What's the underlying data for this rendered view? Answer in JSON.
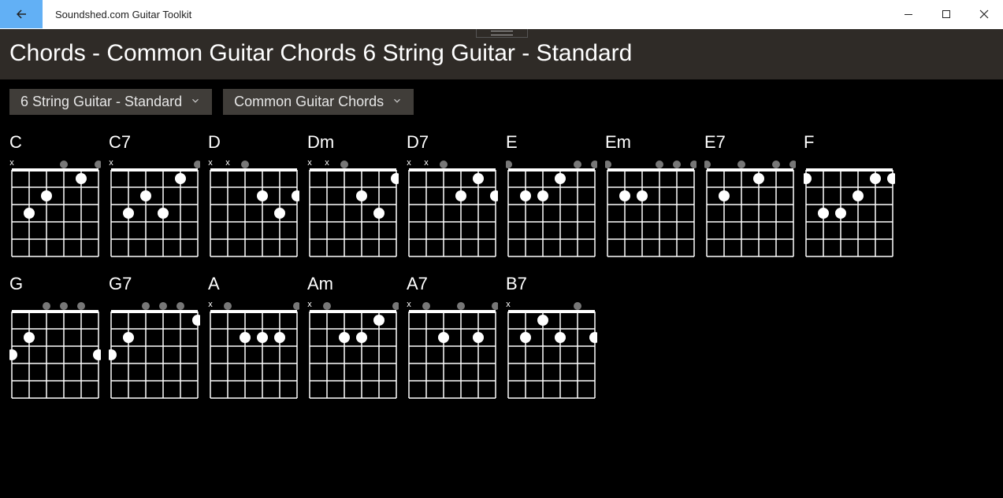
{
  "window": {
    "title": "Soundshed.com Guitar Toolkit"
  },
  "header": {
    "title": "Chords -  Common Guitar Chords 6 String Guitar - Standard"
  },
  "dropdowns": {
    "instrument": "6 String Guitar - Standard",
    "set": "Common Guitar Chords"
  },
  "chart_data": {
    "type": "table",
    "strings": 6,
    "frets_shown": 5,
    "legend": {
      "x": "muted",
      "o": "open",
      "number": "fret pressed"
    },
    "chords": [
      {
        "name": "C",
        "frets": [
          "x",
          3,
          2,
          0,
          1,
          0
        ]
      },
      {
        "name": "C7",
        "frets": [
          "x",
          3,
          2,
          3,
          1,
          0
        ]
      },
      {
        "name": "D",
        "frets": [
          "x",
          "x",
          0,
          2,
          3,
          2
        ]
      },
      {
        "name": "Dm",
        "frets": [
          "x",
          "x",
          0,
          2,
          3,
          1
        ]
      },
      {
        "name": "D7",
        "frets": [
          "x",
          "x",
          0,
          2,
          1,
          2
        ]
      },
      {
        "name": "E",
        "frets": [
          0,
          2,
          2,
          1,
          0,
          0
        ]
      },
      {
        "name": "Em",
        "frets": [
          0,
          2,
          2,
          0,
          0,
          0
        ]
      },
      {
        "name": "E7",
        "frets": [
          0,
          2,
          0,
          1,
          0,
          0
        ]
      },
      {
        "name": "F",
        "frets": [
          1,
          3,
          3,
          2,
          1,
          1
        ]
      },
      {
        "name": "G",
        "frets": [
          3,
          2,
          0,
          0,
          0,
          3
        ]
      },
      {
        "name": "G7",
        "frets": [
          3,
          2,
          0,
          0,
          0,
          1
        ]
      },
      {
        "name": "A",
        "frets": [
          "x",
          0,
          2,
          2,
          2,
          0
        ]
      },
      {
        "name": "Am",
        "frets": [
          "x",
          0,
          2,
          2,
          1,
          0
        ]
      },
      {
        "name": "A7",
        "frets": [
          "x",
          0,
          2,
          0,
          2,
          0
        ]
      },
      {
        "name": "B7",
        "frets": [
          "x",
          2,
          1,
          2,
          0,
          2
        ]
      }
    ]
  }
}
